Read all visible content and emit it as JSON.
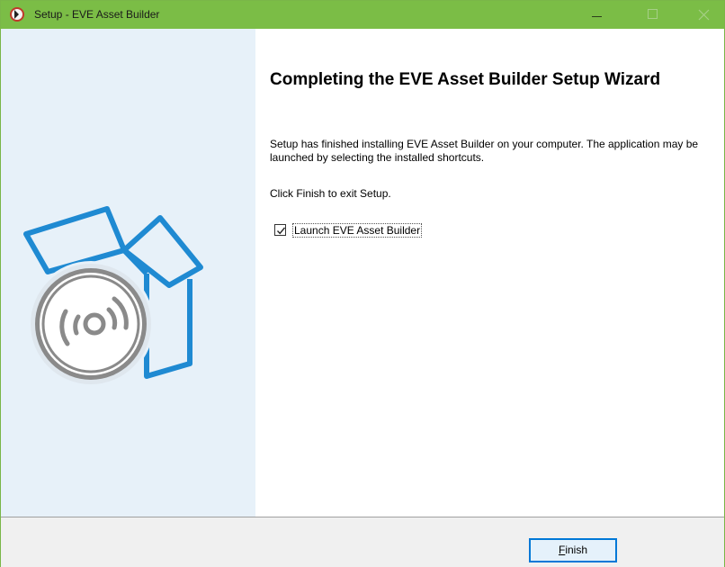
{
  "window": {
    "title": "Setup - EVE Asset Builder",
    "title_icon": "setup-app-icon",
    "accent": "#7bbd46"
  },
  "sidebar": {
    "background": "#e7f1f9",
    "illustration": "box-with-disc-illustration",
    "illustration_color": "#1f8ad2"
  },
  "main": {
    "heading": "Completing the EVE Asset Builder Setup Wizard",
    "description": "Setup has finished installing EVE Asset Builder on your computer. The application may be launched by selecting the installed shortcuts.",
    "exit_instruction": "Click Finish to exit Setup.",
    "launch_checkbox": {
      "label": "Launch EVE Asset Builder",
      "checked": true
    }
  },
  "footer": {
    "finish_accel": "F",
    "finish_rest": "inish"
  }
}
